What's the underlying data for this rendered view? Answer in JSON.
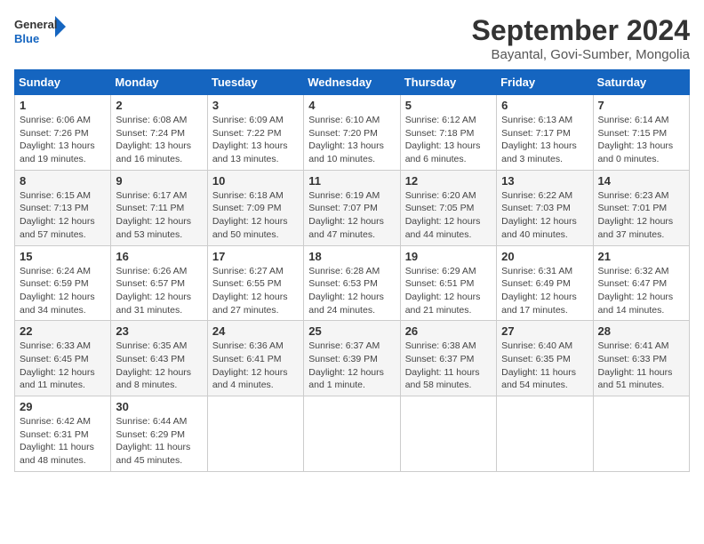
{
  "logo": {
    "general": "General",
    "blue": "Blue"
  },
  "title": "September 2024",
  "subtitle": "Bayantal, Govi-Sumber, Mongolia",
  "headers": [
    "Sunday",
    "Monday",
    "Tuesday",
    "Wednesday",
    "Thursday",
    "Friday",
    "Saturday"
  ],
  "weeks": [
    [
      {
        "day": "1",
        "sunrise": "Sunrise: 6:06 AM",
        "sunset": "Sunset: 7:26 PM",
        "daylight": "Daylight: 13 hours and 19 minutes."
      },
      {
        "day": "2",
        "sunrise": "Sunrise: 6:08 AM",
        "sunset": "Sunset: 7:24 PM",
        "daylight": "Daylight: 13 hours and 16 minutes."
      },
      {
        "day": "3",
        "sunrise": "Sunrise: 6:09 AM",
        "sunset": "Sunset: 7:22 PM",
        "daylight": "Daylight: 13 hours and 13 minutes."
      },
      {
        "day": "4",
        "sunrise": "Sunrise: 6:10 AM",
        "sunset": "Sunset: 7:20 PM",
        "daylight": "Daylight: 13 hours and 10 minutes."
      },
      {
        "day": "5",
        "sunrise": "Sunrise: 6:12 AM",
        "sunset": "Sunset: 7:18 PM",
        "daylight": "Daylight: 13 hours and 6 minutes."
      },
      {
        "day": "6",
        "sunrise": "Sunrise: 6:13 AM",
        "sunset": "Sunset: 7:17 PM",
        "daylight": "Daylight: 13 hours and 3 minutes."
      },
      {
        "day": "7",
        "sunrise": "Sunrise: 6:14 AM",
        "sunset": "Sunset: 7:15 PM",
        "daylight": "Daylight: 13 hours and 0 minutes."
      }
    ],
    [
      {
        "day": "8",
        "sunrise": "Sunrise: 6:15 AM",
        "sunset": "Sunset: 7:13 PM",
        "daylight": "Daylight: 12 hours and 57 minutes."
      },
      {
        "day": "9",
        "sunrise": "Sunrise: 6:17 AM",
        "sunset": "Sunset: 7:11 PM",
        "daylight": "Daylight: 12 hours and 53 minutes."
      },
      {
        "day": "10",
        "sunrise": "Sunrise: 6:18 AM",
        "sunset": "Sunset: 7:09 PM",
        "daylight": "Daylight: 12 hours and 50 minutes."
      },
      {
        "day": "11",
        "sunrise": "Sunrise: 6:19 AM",
        "sunset": "Sunset: 7:07 PM",
        "daylight": "Daylight: 12 hours and 47 minutes."
      },
      {
        "day": "12",
        "sunrise": "Sunrise: 6:20 AM",
        "sunset": "Sunset: 7:05 PM",
        "daylight": "Daylight: 12 hours and 44 minutes."
      },
      {
        "day": "13",
        "sunrise": "Sunrise: 6:22 AM",
        "sunset": "Sunset: 7:03 PM",
        "daylight": "Daylight: 12 hours and 40 minutes."
      },
      {
        "day": "14",
        "sunrise": "Sunrise: 6:23 AM",
        "sunset": "Sunset: 7:01 PM",
        "daylight": "Daylight: 12 hours and 37 minutes."
      }
    ],
    [
      {
        "day": "15",
        "sunrise": "Sunrise: 6:24 AM",
        "sunset": "Sunset: 6:59 PM",
        "daylight": "Daylight: 12 hours and 34 minutes."
      },
      {
        "day": "16",
        "sunrise": "Sunrise: 6:26 AM",
        "sunset": "Sunset: 6:57 PM",
        "daylight": "Daylight: 12 hours and 31 minutes."
      },
      {
        "day": "17",
        "sunrise": "Sunrise: 6:27 AM",
        "sunset": "Sunset: 6:55 PM",
        "daylight": "Daylight: 12 hours and 27 minutes."
      },
      {
        "day": "18",
        "sunrise": "Sunrise: 6:28 AM",
        "sunset": "Sunset: 6:53 PM",
        "daylight": "Daylight: 12 hours and 24 minutes."
      },
      {
        "day": "19",
        "sunrise": "Sunrise: 6:29 AM",
        "sunset": "Sunset: 6:51 PM",
        "daylight": "Daylight: 12 hours and 21 minutes."
      },
      {
        "day": "20",
        "sunrise": "Sunrise: 6:31 AM",
        "sunset": "Sunset: 6:49 PM",
        "daylight": "Daylight: 12 hours and 17 minutes."
      },
      {
        "day": "21",
        "sunrise": "Sunrise: 6:32 AM",
        "sunset": "Sunset: 6:47 PM",
        "daylight": "Daylight: 12 hours and 14 minutes."
      }
    ],
    [
      {
        "day": "22",
        "sunrise": "Sunrise: 6:33 AM",
        "sunset": "Sunset: 6:45 PM",
        "daylight": "Daylight: 12 hours and 11 minutes."
      },
      {
        "day": "23",
        "sunrise": "Sunrise: 6:35 AM",
        "sunset": "Sunset: 6:43 PM",
        "daylight": "Daylight: 12 hours and 8 minutes."
      },
      {
        "day": "24",
        "sunrise": "Sunrise: 6:36 AM",
        "sunset": "Sunset: 6:41 PM",
        "daylight": "Daylight: 12 hours and 4 minutes."
      },
      {
        "day": "25",
        "sunrise": "Sunrise: 6:37 AM",
        "sunset": "Sunset: 6:39 PM",
        "daylight": "Daylight: 12 hours and 1 minute."
      },
      {
        "day": "26",
        "sunrise": "Sunrise: 6:38 AM",
        "sunset": "Sunset: 6:37 PM",
        "daylight": "Daylight: 11 hours and 58 minutes."
      },
      {
        "day": "27",
        "sunrise": "Sunrise: 6:40 AM",
        "sunset": "Sunset: 6:35 PM",
        "daylight": "Daylight: 11 hours and 54 minutes."
      },
      {
        "day": "28",
        "sunrise": "Sunrise: 6:41 AM",
        "sunset": "Sunset: 6:33 PM",
        "daylight": "Daylight: 11 hours and 51 minutes."
      }
    ],
    [
      {
        "day": "29",
        "sunrise": "Sunrise: 6:42 AM",
        "sunset": "Sunset: 6:31 PM",
        "daylight": "Daylight: 11 hours and 48 minutes."
      },
      {
        "day": "30",
        "sunrise": "Sunrise: 6:44 AM",
        "sunset": "Sunset: 6:29 PM",
        "daylight": "Daylight: 11 hours and 45 minutes."
      },
      null,
      null,
      null,
      null,
      null
    ]
  ]
}
